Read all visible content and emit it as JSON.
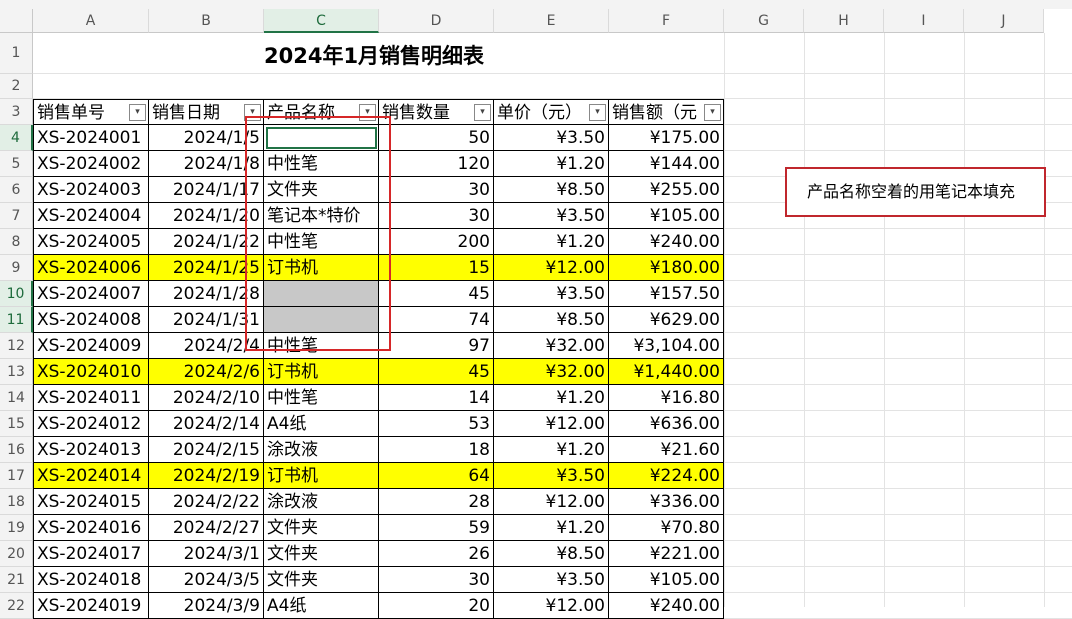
{
  "columns": [
    "A",
    "B",
    "C",
    "D",
    "E",
    "F",
    "G",
    "H",
    "I",
    "J"
  ],
  "selected_column": "C",
  "row_numbers": [
    1,
    2,
    3,
    4,
    5,
    6,
    7,
    8,
    9,
    10,
    11,
    12,
    13,
    14,
    15,
    16,
    17,
    18,
    19,
    20,
    21,
    22
  ],
  "selected_rows": [
    4,
    10,
    11
  ],
  "title": "2024年1月销售明细表",
  "headers": [
    "销售单号",
    "销售日期",
    "产品名称",
    "销售数量",
    "单价（元）",
    "销售额（元"
  ],
  "rows": [
    {
      "id": "XS-2024001",
      "date": "2024/1/5",
      "product": "",
      "qty": "50",
      "price": "¥3.50",
      "amount": "¥175.00",
      "highlight": ""
    },
    {
      "id": "XS-2024002",
      "date": "2024/1/8",
      "product": "中性笔",
      "qty": "120",
      "price": "¥1.20",
      "amount": "¥144.00",
      "highlight": ""
    },
    {
      "id": "XS-2024003",
      "date": "2024/1/17",
      "product": "文件夹",
      "qty": "30",
      "price": "¥8.50",
      "amount": "¥255.00",
      "highlight": ""
    },
    {
      "id": "XS-2024004",
      "date": "2024/1/20",
      "product": "笔记本*特价",
      "qty": "30",
      "price": "¥3.50",
      "amount": "¥105.00",
      "highlight": ""
    },
    {
      "id": "XS-2024005",
      "date": "2024/1/22",
      "product": "中性笔",
      "qty": "200",
      "price": "¥1.20",
      "amount": "¥240.00",
      "highlight": ""
    },
    {
      "id": "XS-2024006",
      "date": "2024/1/25",
      "product": "订书机",
      "qty": "15",
      "price": "¥12.00",
      "amount": "¥180.00",
      "highlight": "yellow"
    },
    {
      "id": "XS-2024007",
      "date": "2024/1/28",
      "product": "",
      "qty": "45",
      "price": "¥3.50",
      "amount": "¥157.50",
      "highlight": "gray"
    },
    {
      "id": "XS-2024008",
      "date": "2024/1/31",
      "product": "",
      "qty": "74",
      "price": "¥8.50",
      "amount": "¥629.00",
      "highlight": "gray"
    },
    {
      "id": "XS-2024009",
      "date": "2024/2/4",
      "product": "中性笔",
      "qty": "97",
      "price": "¥32.00",
      "amount": "¥3,104.00",
      "highlight": ""
    },
    {
      "id": "XS-2024010",
      "date": "2024/2/6",
      "product": "订书机",
      "qty": "45",
      "price": "¥32.00",
      "amount": "¥1,440.00",
      "highlight": "yellow"
    },
    {
      "id": "XS-2024011",
      "date": "2024/2/10",
      "product": "中性笔",
      "qty": "14",
      "price": "¥1.20",
      "amount": "¥16.80",
      "highlight": ""
    },
    {
      "id": "XS-2024012",
      "date": "2024/2/14",
      "product": "A4纸",
      "qty": "53",
      "price": "¥12.00",
      "amount": "¥636.00",
      "highlight": ""
    },
    {
      "id": "XS-2024013",
      "date": "2024/2/15",
      "product": "涂改液",
      "qty": "18",
      "price": "¥1.20",
      "amount": "¥21.60",
      "highlight": ""
    },
    {
      "id": "XS-2024014",
      "date": "2024/2/19",
      "product": "订书机",
      "qty": "64",
      "price": "¥3.50",
      "amount": "¥224.00",
      "highlight": "yellow"
    },
    {
      "id": "XS-2024015",
      "date": "2024/2/22",
      "product": "涂改液",
      "qty": "28",
      "price": "¥12.00",
      "amount": "¥336.00",
      "highlight": ""
    },
    {
      "id": "XS-2024016",
      "date": "2024/2/27",
      "product": "文件夹",
      "qty": "59",
      "price": "¥1.20",
      "amount": "¥70.80",
      "highlight": ""
    },
    {
      "id": "XS-2024017",
      "date": "2024/3/1",
      "product": "文件夹",
      "qty": "26",
      "price": "¥8.50",
      "amount": "¥221.00",
      "highlight": ""
    },
    {
      "id": "XS-2024018",
      "date": "2024/3/5",
      "product": "文件夹",
      "qty": "30",
      "price": "¥3.50",
      "amount": "¥105.00",
      "highlight": ""
    },
    {
      "id": "XS-2024019",
      "date": "2024/3/9",
      "product": "A4纸",
      "qty": "20",
      "price": "¥12.00",
      "amount": "¥240.00",
      "highlight": ""
    }
  ],
  "annotation": "产品名称空着的用笔记本填充",
  "colors": {
    "highlight_yellow": "#ffff00",
    "selection_gray": "#c8c8c8",
    "annotation_red": "#d62728",
    "excel_green": "#217346"
  },
  "icons": {
    "filter_dropdown": "dropdown-arrow-icon"
  }
}
